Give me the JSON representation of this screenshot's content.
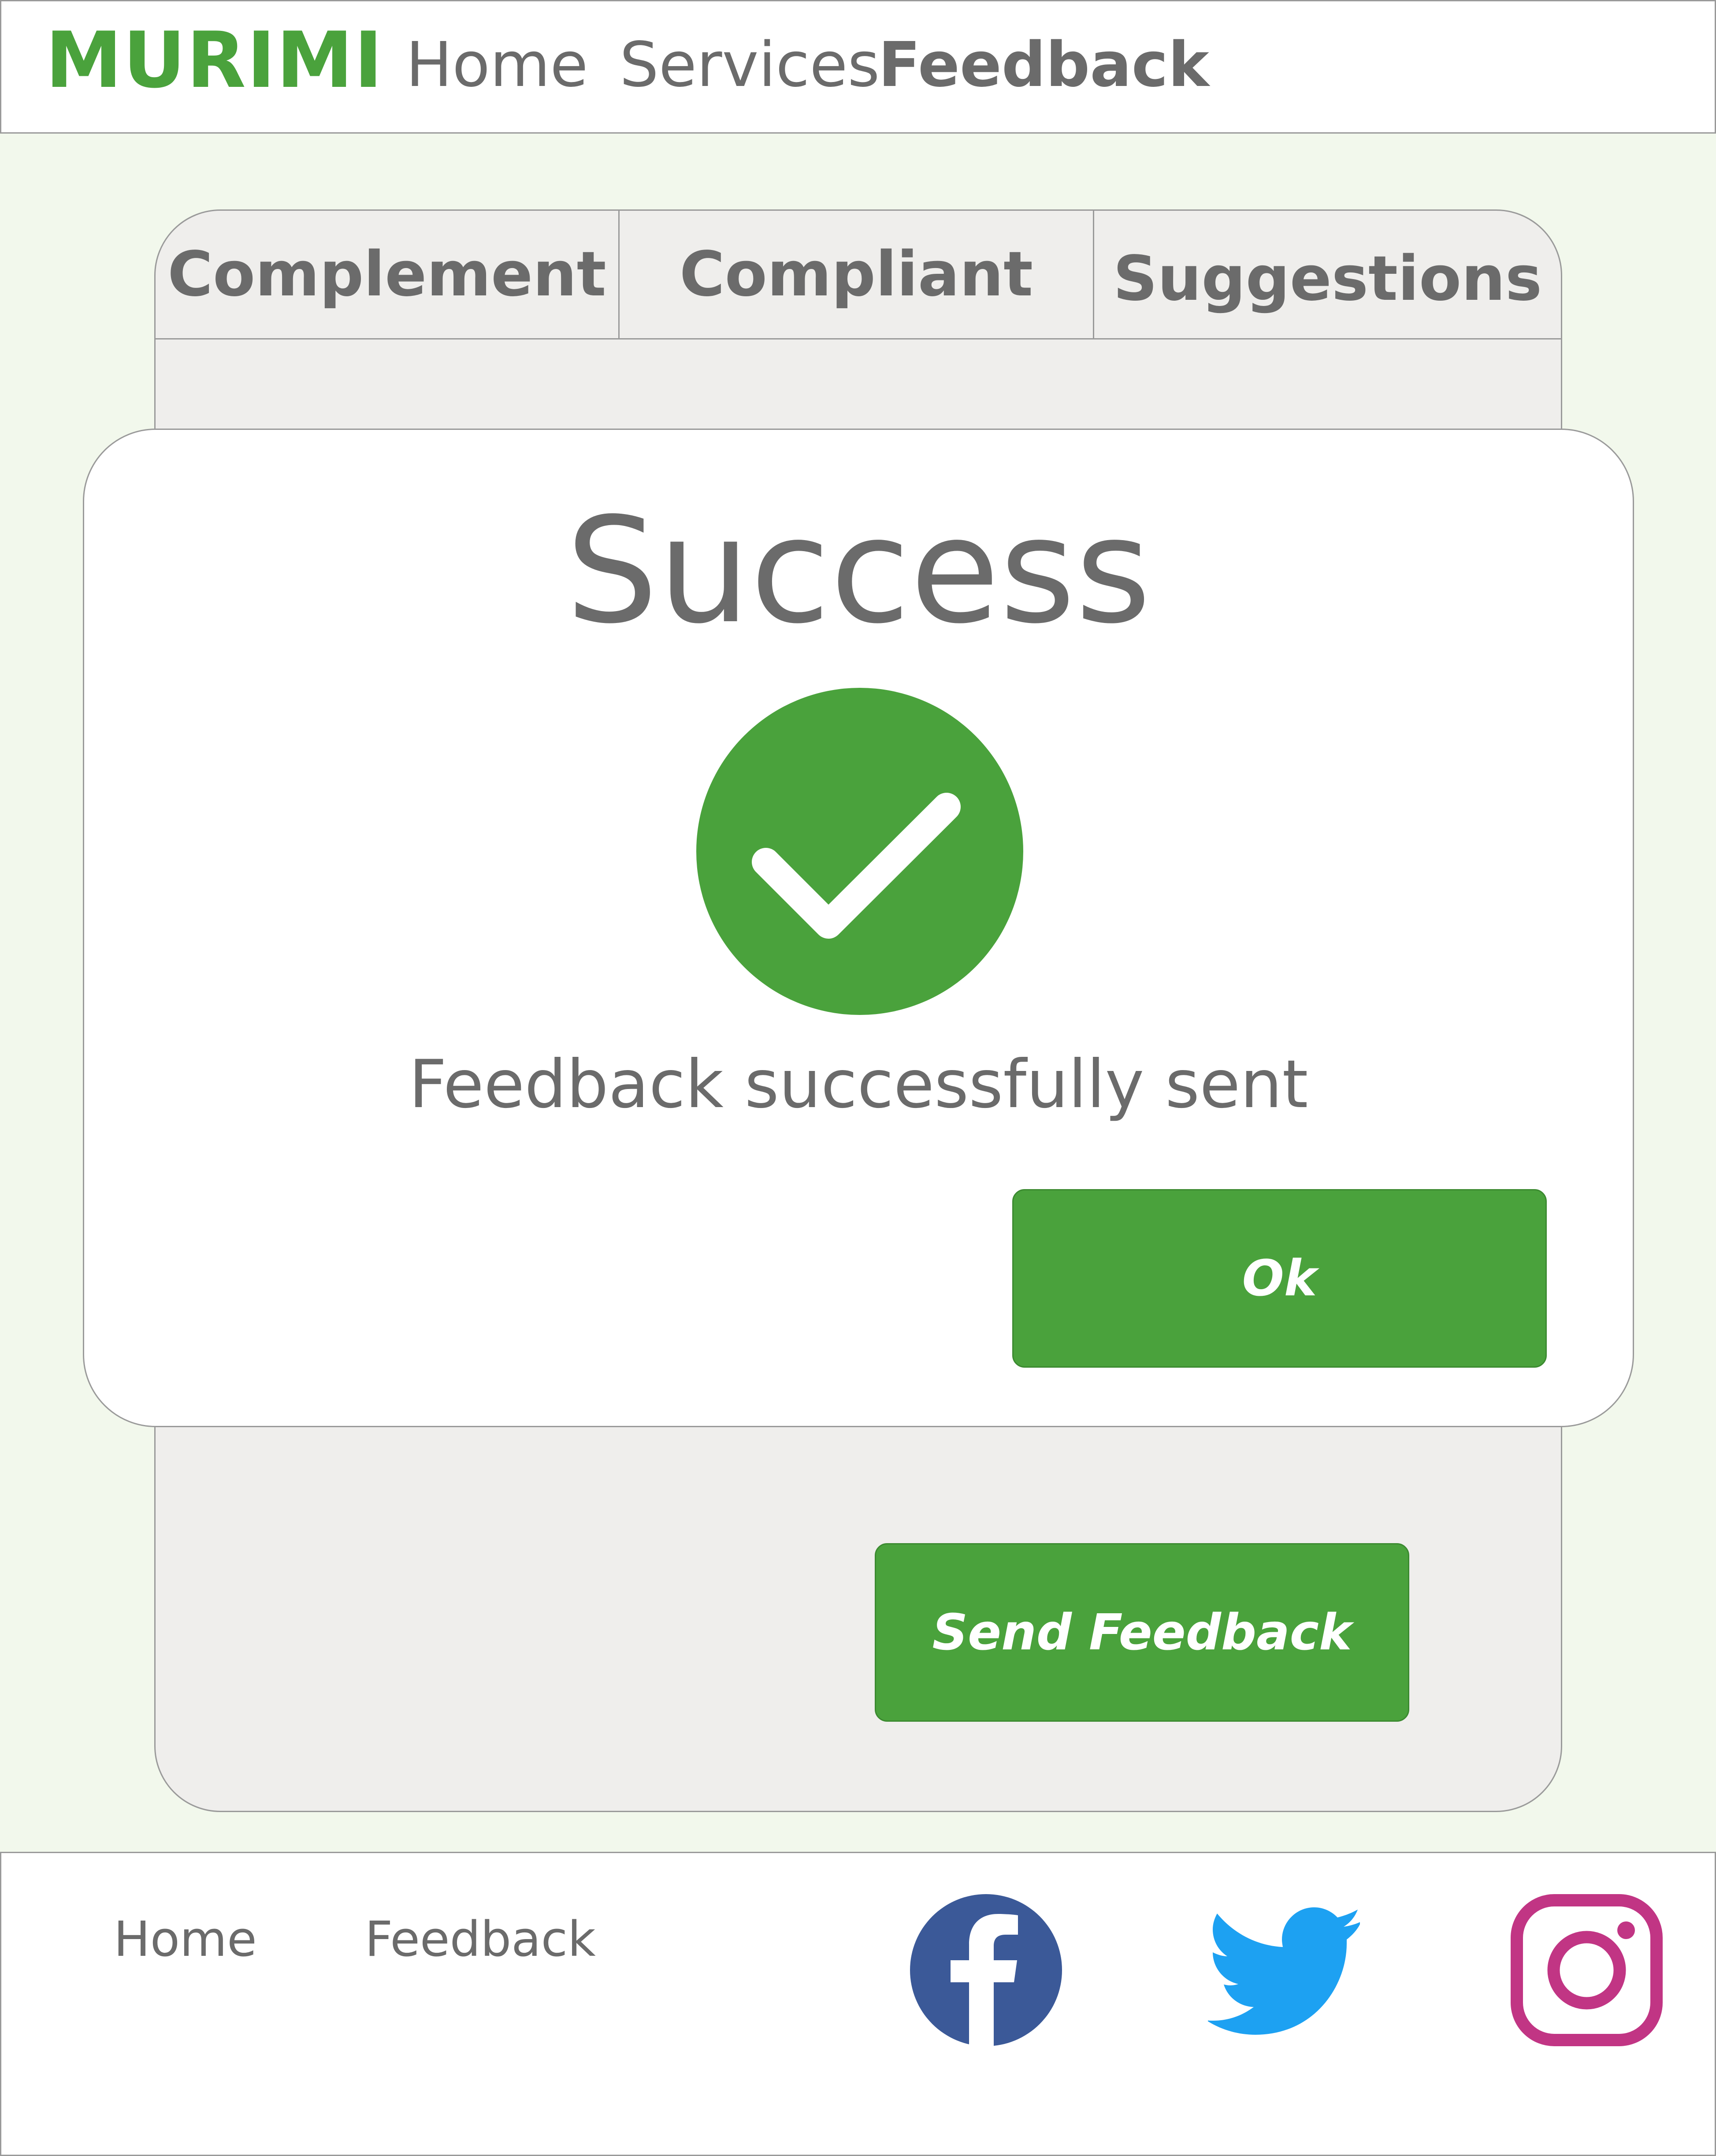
{
  "header": {
    "logo_text": "MURIMI",
    "nav": {
      "home": "Home",
      "services": "Services",
      "feedback": "Feedback"
    }
  },
  "tabs": {
    "complement": "Complement",
    "compliant": "Compliant",
    "suggestions": "Suggestions"
  },
  "panel": {
    "send_button": "Send Feedback"
  },
  "modal": {
    "title": "Success",
    "message": "Feedback successfully sent",
    "ok_button": "Ok",
    "icon": "check-circle-icon"
  },
  "footer": {
    "links": {
      "home": "Home",
      "feedback": "Feedback"
    },
    "social": [
      "facebook-icon",
      "twitter-icon",
      "instagram-icon"
    ]
  },
  "colors": {
    "brand_green": "#4aa23c",
    "page_bg": "#f2f8ec",
    "panel_bg": "#efeeec",
    "text_gray": "#6b6b6b",
    "facebook_blue": "#3b5998",
    "twitter_blue": "#1da1f2",
    "instagram_magenta": "#c13584"
  }
}
